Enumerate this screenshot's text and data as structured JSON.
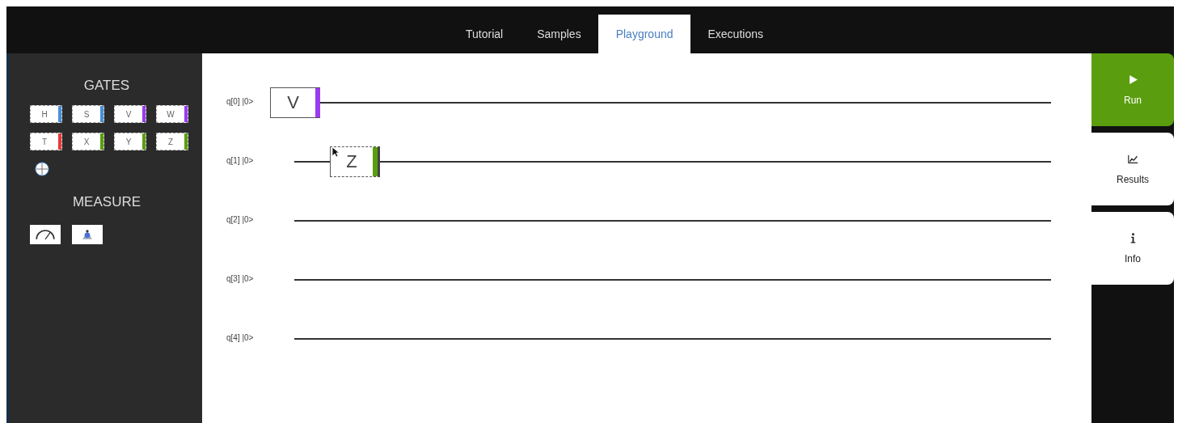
{
  "tabs": [
    {
      "label": "Tutorial",
      "selected": false
    },
    {
      "label": "Samples",
      "selected": false
    },
    {
      "label": "Playground",
      "selected": true
    },
    {
      "label": "Executions",
      "selected": false
    }
  ],
  "palette": {
    "gates_title": "GATES",
    "gates": [
      {
        "label": "H",
        "color": "#4a8fd8"
      },
      {
        "label": "S",
        "color": "#4a8fd8"
      },
      {
        "label": "V",
        "color": "#9b3bf0"
      },
      {
        "label": "W",
        "color": "#9b3bf0"
      },
      {
        "label": "T",
        "color": "#e83a3a"
      },
      {
        "label": "X",
        "color": "#5a9e0f"
      },
      {
        "label": "Y",
        "color": "#5a9e0f"
      },
      {
        "label": "Z",
        "color": "#5a9e0f"
      }
    ],
    "measure_title": "MEASURE"
  },
  "circuit": {
    "qubits": [
      {
        "label": "q[0] |0>",
        "gates": [
          {
            "label": "V",
            "color": "#9b3bf0",
            "dragging": false
          }
        ]
      },
      {
        "label": "q[1] |0>",
        "gates": [
          {
            "label": "Z",
            "color": "#5a9e0f",
            "dragging": true
          }
        ]
      },
      {
        "label": "q[2] |0>"
      },
      {
        "label": "q[3] |0>"
      },
      {
        "label": "q[4] |0>"
      }
    ]
  },
  "actions": [
    {
      "kind": "run",
      "label": "Run"
    },
    {
      "kind": "results",
      "label": "Results"
    },
    {
      "kind": "info",
      "label": "Info"
    }
  ]
}
